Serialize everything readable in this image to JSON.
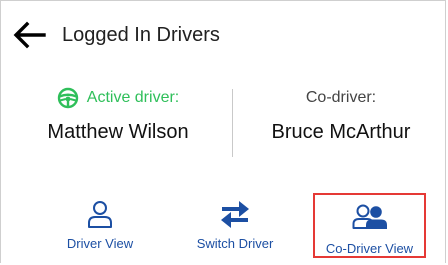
{
  "header": {
    "title": "Logged In Drivers"
  },
  "active_driver": {
    "role_label": "Active driver:",
    "name": "Matthew Wilson",
    "icon": "steering-wheel-icon",
    "color": "#2fbf5a"
  },
  "co_driver": {
    "role_label": "Co-driver:",
    "name": "Bruce McArthur"
  },
  "nav": {
    "driver_view_label": "Driver View",
    "switch_driver_label": "Switch Driver",
    "co_driver_view_label": "Co-Driver View",
    "accent_color": "#1c4fa3",
    "highlight_color": "#e53935"
  }
}
